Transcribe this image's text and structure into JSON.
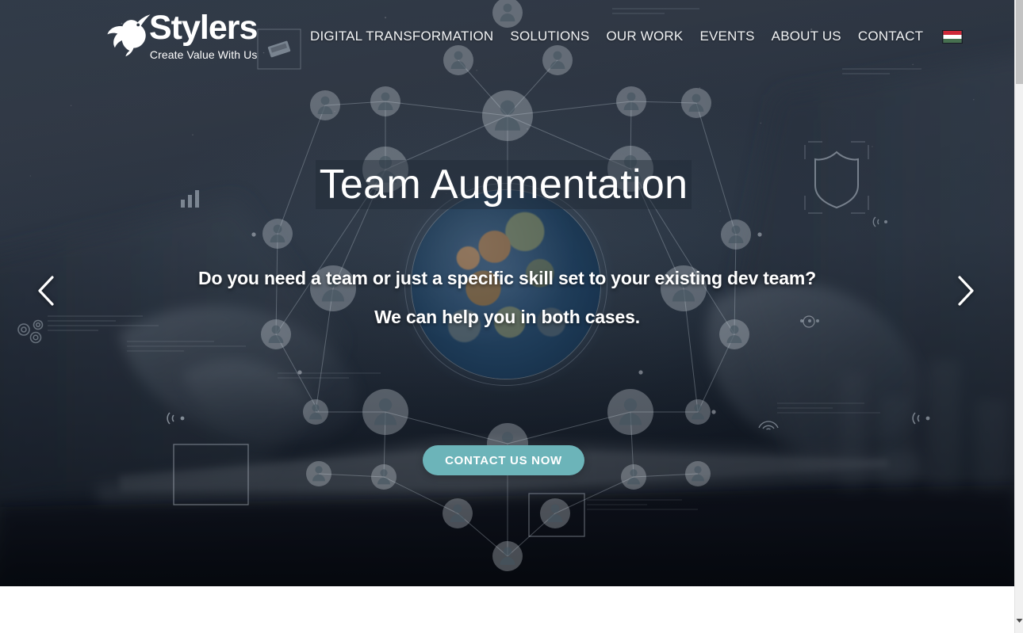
{
  "header": {
    "logo": {
      "icon": "hummingbird-logo-icon",
      "wordmark": "Stylers",
      "tagline": "Create Value With Us"
    },
    "nav": [
      {
        "label": "DIGITAL TRANSFORMATION",
        "name": "nav-item-digital-transformation"
      },
      {
        "label": "SOLUTIONS",
        "name": "nav-item-solutions"
      },
      {
        "label": "OUR WORK",
        "name": "nav-item-our-work"
      },
      {
        "label": "EVENTS",
        "name": "nav-item-events"
      },
      {
        "label": "ABOUT US",
        "name": "nav-item-about-us"
      },
      {
        "label": "CONTACT",
        "name": "nav-item-contact"
      }
    ],
    "language": {
      "icon": "hungarian-flag-icon",
      "stripes": [
        "#ce2939",
        "#ffffff",
        "#477050"
      ]
    }
  },
  "hero": {
    "title": "Team Augmentation",
    "subtitle_line1": "Do you need a team or just a specific skill set to your existing dev team?",
    "subtitle_line2": "We can help you in both cases.",
    "cta_label": "CONTACT US NOW",
    "cta_color": "#6cb4b9",
    "prev_icon": "chevron-left-icon",
    "next_icon": "chevron-right-icon",
    "background": {
      "description": "hands-on-tablet-photo",
      "overlay_icons": [
        "globe-icon",
        "person-node-icon",
        "shield-icon",
        "gears-icon",
        "wifi-signal-icon",
        "bar-chart-icon",
        "fingerprint-icon",
        "chip-icon"
      ],
      "tint_color": "#1b2430"
    }
  },
  "browser": {
    "scrollbar": {
      "track_color": "#f1f1f1",
      "thumb_color": "#c3c3c3",
      "down_arrow_icon": "scroll-down-arrow-icon"
    }
  }
}
